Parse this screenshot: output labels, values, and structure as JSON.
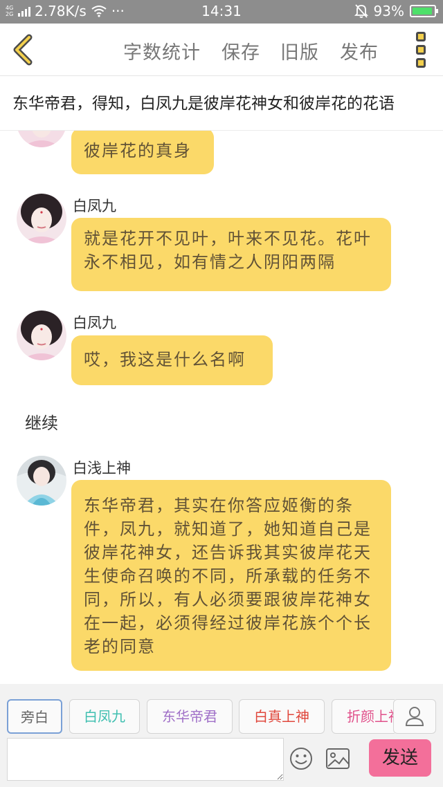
{
  "status_bar": {
    "network_label": "4G 2G",
    "speed": "2.78K/s",
    "dots": "···",
    "time": "14:31",
    "battery": "93%",
    "battery_level": 0.93
  },
  "header": {
    "back_icon": "chevron-left-icon",
    "actions": [
      "字数统计",
      "保存",
      "旧版",
      "发布"
    ],
    "more_icon": "more-vertical-icon",
    "accent_color": "#f3d04d"
  },
  "story_title": "东华帝君，得知，白凤九是彼岸花神女和彼岸花的花语",
  "messages": [
    {
      "speaker": "",
      "text": "彼岸花的真身"
    },
    {
      "speaker": "白凤九",
      "text": "就是花开不见叶，叶来不见花。花叶永不相见，如有情之人阴阳两隔"
    },
    {
      "speaker": "白凤九",
      "text": "哎，我这是什么名啊"
    },
    {
      "narration": "继续"
    },
    {
      "speaker": "白浅上神",
      "text": "东华帝君，其实在你答应姬衡的条件，凤九，就知道了，她知道自己是彼岸花神女，还告诉我其实彼岸花天生使命召唤的不同，所承载的任务不同，所以，有人必须要跟彼岸花神女在一起，必须得经过彼岸花族个个长老的同意"
    }
  ],
  "bubble_color": "#fbd969",
  "characters": [
    {
      "name": "旁白",
      "color": "#666666",
      "active": true
    },
    {
      "name": "白凤九",
      "color": "#3fbfb0",
      "active": false
    },
    {
      "name": "东华帝君",
      "color": "#a070c8",
      "active": false
    },
    {
      "name": "白真上神",
      "color": "#e0473c",
      "active": false
    },
    {
      "name": "折颜上神",
      "color": "#e0508a",
      "active": false
    }
  ],
  "composer": {
    "placeholder": "",
    "emoji_icon": "emoji-icon",
    "image_icon": "image-icon",
    "user_icon": "user-icon",
    "send_label": "发送",
    "send_color": "#f36f9a"
  }
}
